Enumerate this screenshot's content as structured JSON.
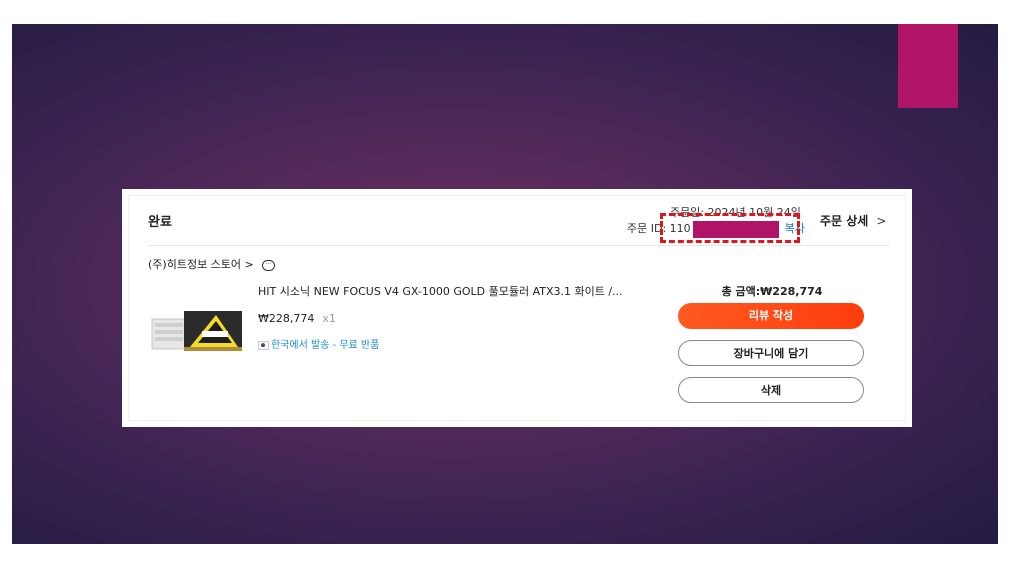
{
  "colors": {
    "accent_block": "#b01466",
    "redaction": "#b01466",
    "highlight_box": "#e0141b",
    "primary_button": "#ff4a14",
    "link": "#1a73e8",
    "shipping_text": "#1a8fd6"
  },
  "order": {
    "status": "완료",
    "date_text": "주문일: 2024년 10월 24일",
    "id_label": "주문 ID: 110",
    "copy_label": "복사",
    "detail_label": "주문 상세",
    "detail_chevron": ">"
  },
  "store": {
    "name": "(주)히트정보 스토어 >",
    "chat_icon": "chat-bubble-icon"
  },
  "product": {
    "title": "HIT 시소닉 NEW FOCUS V4 GX-1000 GOLD 풀모듈러 ATX3.1 화이트 /...",
    "price": "₩228,774",
    "quantity": "x1",
    "shipping": "한국에서 발송 - 무료 반품",
    "flag_icon": "korea-flag-icon"
  },
  "summary": {
    "total": "총 금액:₩228,774"
  },
  "actions": {
    "review": "리뷰 작성",
    "cart": "장바구니에 담기",
    "delete": "삭제"
  }
}
